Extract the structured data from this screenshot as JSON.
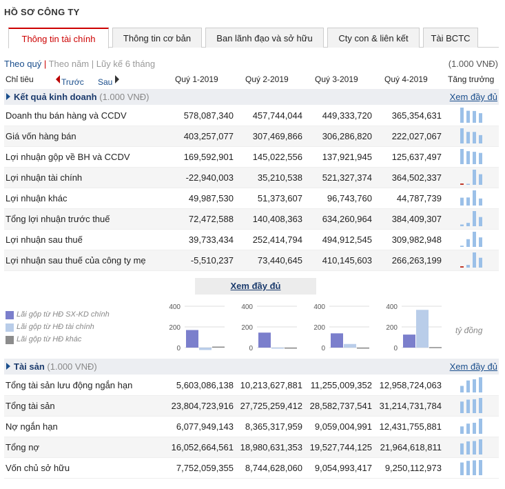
{
  "page_title": "HỒ SƠ CÔNG TY",
  "tabs": [
    {
      "label": "Thông tin tài chính",
      "active": true
    },
    {
      "label": "Thông tin cơ bản",
      "active": false
    },
    {
      "label": "Ban lãnh đạo và sở hữu",
      "active": false
    },
    {
      "label": "Cty con & liên kết",
      "active": false
    },
    {
      "label": "Tài BCTC",
      "active": false
    }
  ],
  "view_options": {
    "quarter": "Theo quý",
    "sep1": "|",
    "year": "Theo năm",
    "sep2": "|",
    "ytd": "Lũy kế 6 tháng"
  },
  "unit_label": "(1.000 VNĐ)",
  "header": {
    "indicator": "Chỉ tiêu",
    "prev": "Trước",
    "next": "Sau",
    "growth": "Tăng trưởng",
    "quarters": [
      "Quý 1-2019",
      "Quý 2-2019",
      "Quý 3-2019",
      "Quý 4-2019"
    ]
  },
  "colors": {
    "bar_main": "#7b7fcc",
    "bar_fin": "#b9cde9",
    "bar_other": "#8c8c8c",
    "spark": "#9bc0e8",
    "neg": "#c0392b",
    "accent": "#c00"
  },
  "sections": {
    "results": {
      "title": "Kết quả kinh doanh",
      "unit": "(1.000 VNĐ)",
      "more": "Xem đầy đủ",
      "rows": [
        {
          "name": "Doanh thu bán hàng và CCDV",
          "values": [
            "578,087,340",
            "457,744,044",
            "449,333,720",
            "365,354,631"
          ],
          "nums": [
            578087340,
            457744044,
            449333720,
            365354631
          ]
        },
        {
          "name": "Giá vốn hàng bán",
          "values": [
            "403,257,077",
            "307,469,866",
            "306,286,820",
            "222,027,067"
          ],
          "nums": [
            403257077,
            307469866,
            306286820,
            222027067
          ]
        },
        {
          "name": "Lợi nhuận gộp về BH và CCDV",
          "values": [
            "169,592,901",
            "145,022,556",
            "137,921,945",
            "125,637,497"
          ],
          "nums": [
            169592901,
            145022556,
            137921945,
            125637497
          ]
        },
        {
          "name": "Lợi nhuận tài chính",
          "values": [
            "-22,940,003",
            "35,210,538",
            "521,327,374",
            "364,502,337"
          ],
          "nums": [
            -22940003,
            35210538,
            521327374,
            364502337
          ]
        },
        {
          "name": "Lợi nhuận khác",
          "values": [
            "49,987,530",
            "51,373,607",
            "96,743,760",
            "44,787,739"
          ],
          "nums": [
            49987530,
            51373607,
            96743760,
            44787739
          ]
        },
        {
          "name": "Tổng lợi nhuận trước thuế",
          "values": [
            "72,472,588",
            "140,408,363",
            "634,260,964",
            "384,409,307"
          ],
          "nums": [
            72472588,
            140408363,
            634260964,
            384409307
          ]
        },
        {
          "name": "Lợi nhuận sau thuế",
          "values": [
            "39,733,434",
            "252,414,794",
            "494,912,545",
            "309,982,948"
          ],
          "nums": [
            39733434,
            252414794,
            494912545,
            309982948
          ]
        },
        {
          "name": "Lợi nhuận sau thuế của công ty mẹ",
          "values": [
            "-5,510,237",
            "73,440,645",
            "410,145,603",
            "266,263,199"
          ],
          "nums": [
            -5510237,
            73440645,
            410145603,
            266263199
          ]
        }
      ]
    },
    "assets": {
      "title": "Tài sản",
      "unit": "(1.000 VNĐ)",
      "more": "Xem đầy đủ",
      "rows": [
        {
          "name": "Tổng tài sản lưu động ngắn hạn",
          "values": [
            "5,603,086,138",
            "10,213,627,881",
            "11,255,009,352",
            "12,958,724,063"
          ],
          "nums": [
            5603086138,
            10213627881,
            11255009352,
            12958724063
          ]
        },
        {
          "name": "Tổng tài sản",
          "values": [
            "23,804,723,916",
            "27,725,259,412",
            "28,582,737,541",
            "31,214,731,784"
          ],
          "nums": [
            23804723916,
            27725259412,
            28582737541,
            31214731784
          ]
        },
        {
          "name": "Nợ ngắn hạn",
          "values": [
            "6,077,949,143",
            "8,365,317,959",
            "9,059,004,991",
            "12,431,755,881"
          ],
          "nums": [
            6077949143,
            8365317959,
            9059004991,
            12431755881
          ]
        },
        {
          "name": "Tổng nợ",
          "values": [
            "16,052,664,561",
            "18,980,631,353",
            "19,527,744,125",
            "21,964,618,811"
          ],
          "nums": [
            16052664561,
            18980631353,
            19527744125,
            21964618811
          ]
        },
        {
          "name": "Vốn chủ sở hữu",
          "values": [
            "7,752,059,355",
            "8,744,628,060",
            "9,054,993,417",
            "9,250,112,973"
          ],
          "nums": [
            7752059355,
            8744628060,
            9054993417,
            9250112973
          ]
        }
      ]
    }
  },
  "more_center": "Xem đầy đủ",
  "legend": [
    "Lãi gộp từ HĐ SX-KD chính",
    "Lãi gộp từ HĐ tài chính",
    "Lãi gộp từ HĐ khác"
  ],
  "unit_bn": "tỷ đồng",
  "chart_data": {
    "type": "bar",
    "categories": [
      "Quý 1-2019",
      "Quý 2-2019",
      "Quý 3-2019",
      "Quý 4-2019"
    ],
    "yticks": [
      "400",
      "200",
      "0"
    ],
    "ylim": [
      0,
      400
    ],
    "series": [
      {
        "name": "Lãi gộp từ HĐ SX-KD chính",
        "values": [
          170,
          145,
          138,
          126
        ]
      },
      {
        "name": "Lãi gộp từ HĐ tài chính",
        "values": [
          -23,
          -10,
          35,
          365
        ]
      },
      {
        "name": "Lãi gộp từ HĐ khác",
        "values": [
          10,
          0,
          0,
          5
        ]
      }
    ]
  }
}
